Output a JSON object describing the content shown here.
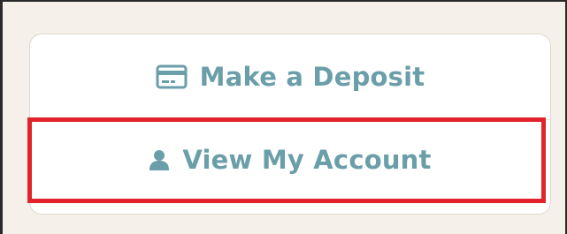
{
  "menu": {
    "deposit_label": "Make a Deposit",
    "deposit_icon": "credit-card-icon",
    "account_label": "View My Account",
    "account_icon": "user-icon"
  },
  "colors": {
    "accent": "#6a9ea9",
    "highlight": "#e3232c",
    "background": "#f5f1ea"
  }
}
